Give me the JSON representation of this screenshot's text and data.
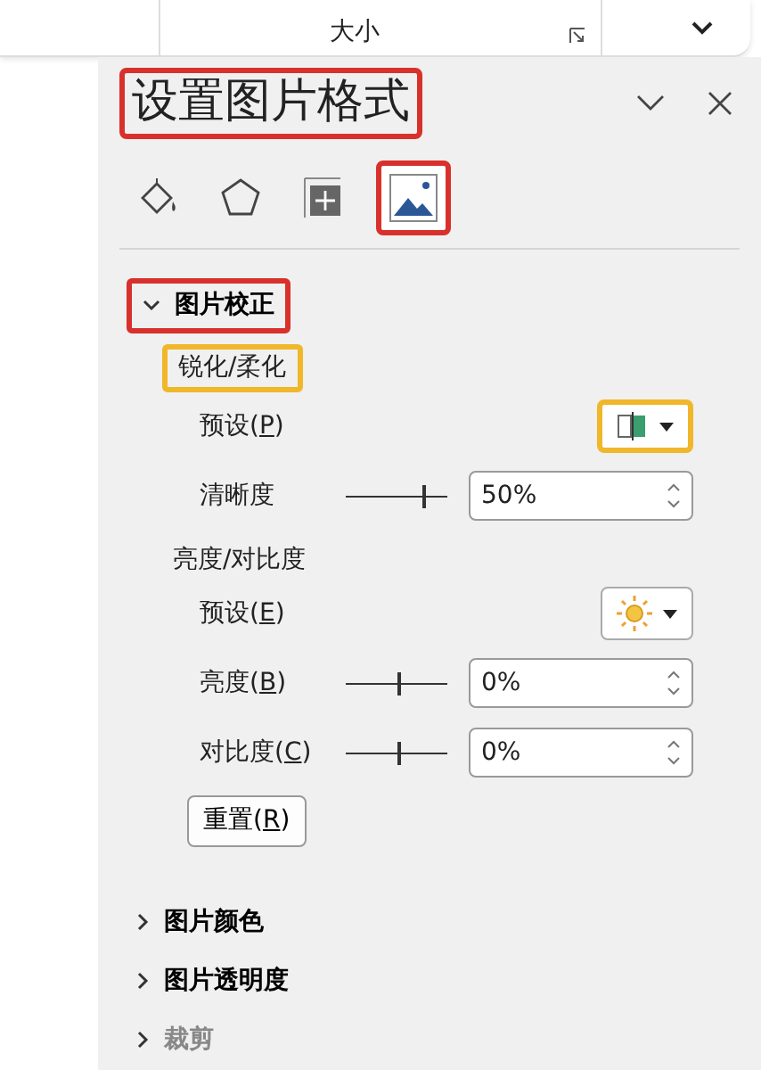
{
  "ribbon": {
    "group_label": "大小"
  },
  "pane": {
    "title": {
      "text": "设置图片格式",
      "color": "#d8312c"
    },
    "tabs": [
      {
        "kind": "fill",
        "selected": false
      },
      {
        "kind": "effects",
        "selected": false
      },
      {
        "kind": "size",
        "selected": false
      },
      {
        "kind": "picture",
        "selected": true,
        "color": "#d8312c"
      }
    ],
    "sections": [
      {
        "title": "图片校正",
        "expanded": true,
        "color": "#d8312c",
        "groups": [
          {
            "label": "锐化/柔化",
            "color": "#f0b72a",
            "rows": [
              {
                "kind": "preset",
                "label": "预设(",
                "access_key": "P",
                "after": ")",
                "color": "#f0b72a"
              },
              {
                "kind": "slider",
                "label": "清晰度",
                "level": 0.75,
                "value": "50%"
              }
            ]
          },
          {
            "label": "亮度/对比度",
            "rows": [
              {
                "kind": "preset",
                "label": "预设(",
                "access_key": "E",
                "after": ")"
              },
              {
                "kind": "slider",
                "label": "亮度(",
                "access_key": "B",
                "after": ")",
                "level": 0.5,
                "value": "0%"
              },
              {
                "kind": "slider",
                "label": "对比度(",
                "access_key": "C",
                "after": ")",
                "level": 0.5,
                "value": "0%"
              },
              {
                "kind": "button",
                "label": "重置(",
                "access_key": "R",
                "after": ")"
              }
            ]
          }
        ]
      },
      {
        "title": "图片颜色",
        "expanded": false
      },
      {
        "title": "图片透明度",
        "expanded": false
      },
      {
        "title": "裁剪",
        "expanded": false
      }
    ]
  }
}
